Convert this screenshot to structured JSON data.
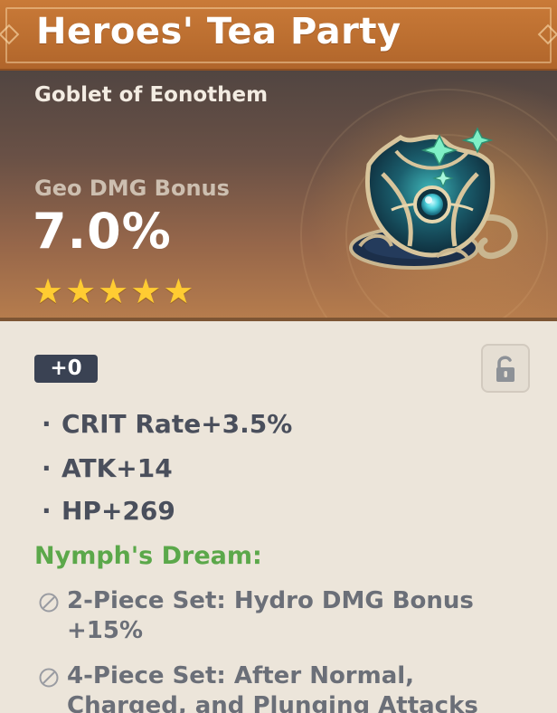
{
  "artifact": {
    "name": "Heroes' Tea Party",
    "slot_type": "Goblet of Eonothem",
    "main_stat": {
      "name": "Geo DMG Bonus",
      "value": "7.0%"
    },
    "rarity_stars": 5,
    "level": "+0",
    "locked": false,
    "icon": "goblet-artifact-icon"
  },
  "substats": [
    {
      "bullet": "·",
      "text": "CRIT Rate+3.5%"
    },
    {
      "bullet": "·",
      "text": "ATK+14"
    },
    {
      "bullet": "·",
      "text": "HP+269"
    }
  ],
  "set": {
    "name": "Nymph's Dream:",
    "bonuses": [
      {
        "text": "2-Piece Set: Hydro DMG Bonus +15%"
      },
      {
        "text": "4-Piece Set: After Normal, Charged, and Plunging Attacks"
      }
    ]
  },
  "colors": {
    "title_bar": "#bb6e30",
    "star": "#ffcc32",
    "set_name": "#5ba84a",
    "level_badge": "#3a4253"
  }
}
